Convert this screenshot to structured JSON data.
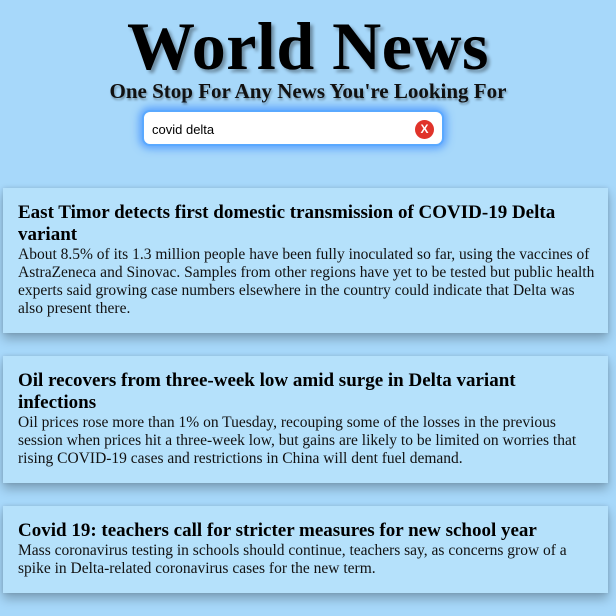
{
  "header": {
    "title": "World News",
    "tagline": "One Stop For Any News You're Looking For"
  },
  "search": {
    "value": "covid delta",
    "clear_label": "X"
  },
  "articles": [
    {
      "title": "East Timor detects first domestic transmission of COVID-19 Delta variant",
      "summary": "About 8.5% of its 1.3 million people have been fully inoculated so far, using the vaccines of AstraZeneca and Sinovac. Samples from other regions have yet to be tested but public health experts said growing case numbers elsewhere in the country could indicate that Delta was also present there."
    },
    {
      "title": "Oil recovers from three-week low amid surge in Delta variant infections",
      "summary": "Oil prices rose more than 1% on Tuesday, recouping some of the losses in the previous session when prices hit a three-week low, but gains are likely to be limited on worries that rising COVID-19 cases and restrictions in China will dent fuel demand."
    },
    {
      "title": "Covid 19: teachers call for stricter measures for new school year",
      "summary": "Mass coronavirus testing in schools should continue, teachers say, as concerns grow of a spike in Delta-related coronavirus cases for the new term."
    }
  ],
  "colors": {
    "page_background": "#a7d8fa",
    "card_background": "#b5e1fb",
    "search_glow": "#5aa9ff",
    "clear_button": "#e0332a"
  }
}
